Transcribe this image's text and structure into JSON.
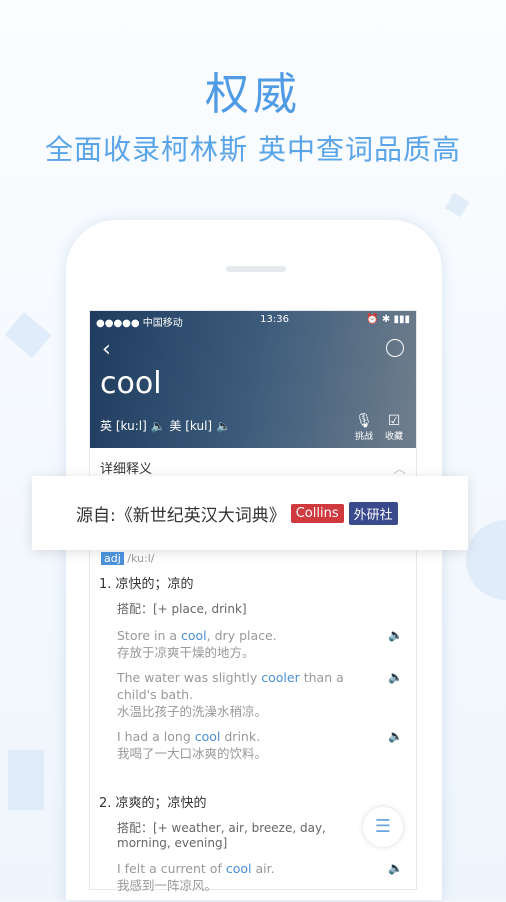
{
  "headline": "权威",
  "subheadline": "全面收录柯林斯  英中查词品质高",
  "status": {
    "carrier": "●●●●● 中国移动",
    "time": "13:36",
    "right": "⏰ ✱ ▮▮▮"
  },
  "word": "cool",
  "phonetics": {
    "uk_label": "英",
    "uk": "[ku:l]",
    "us_label": "美",
    "us": "[kul]"
  },
  "tools": [
    {
      "label": "挑战",
      "icon": "microphone-icon"
    },
    {
      "label": "收藏",
      "icon": "bookmark-icon"
    }
  ],
  "section_title": "详细释义",
  "source": {
    "text": "源自:《新世纪英汉大词典》",
    "badges": [
      {
        "label": "Collins",
        "color": "#d0393e"
      },
      {
        "label": "外研社",
        "color": "#3b4a8c"
      }
    ]
  },
  "pos": {
    "tag": "adj",
    "phonetic": "/ku:l/"
  },
  "senses": [
    {
      "title": "1. 凉快的；凉的",
      "collocation": "搭配：[+ place, drink]",
      "examples": [
        {
          "before": "Store in a ",
          "hl": "cool",
          "after": ", dry place.",
          "zh": "存放于凉爽干燥的地方。"
        },
        {
          "before": "The water was slightly ",
          "hl": "cooler",
          "after": " than a child's bath.",
          "zh": "水温比孩子的洗澡水稍凉。"
        },
        {
          "before": "I had a long ",
          "hl": "cool",
          "after": " drink.",
          "zh": "我喝了一大口冰爽的饮料。"
        }
      ]
    },
    {
      "title": "2. 凉爽的；凉快的",
      "collocation": "搭配：[+ weather, air, breeze, day, morning, evening]",
      "examples": [
        {
          "before": "I felt a current of ",
          "hl": "cool",
          "after": " air.",
          "zh": "我感到一阵凉风。"
        }
      ]
    }
  ]
}
